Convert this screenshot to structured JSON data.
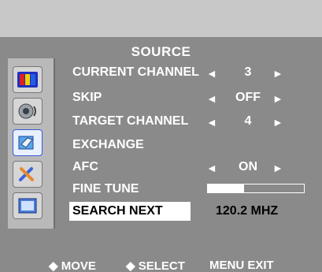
{
  "menu": {
    "title": "SOURCE"
  },
  "rows": {
    "current_channel": {
      "label": "CURRENT CHANNEL",
      "value": "3"
    },
    "skip": {
      "label": "SKIP",
      "value": "OFF"
    },
    "target_channel": {
      "label": "TARGET CHANNEL",
      "value": "4"
    },
    "exchange": {
      "label": "EXCHANGE"
    },
    "afc": {
      "label": "AFC",
      "value": "ON"
    },
    "fine_tune": {
      "label": "FINE TUNE",
      "level": 0.38
    },
    "search_next": {
      "label": "SEARCH NEXT",
      "frequency": "120.2 MHZ"
    }
  },
  "arrows": {
    "left": "◄",
    "right": "►"
  },
  "footer": {
    "move": "◆ MOVE",
    "select": "◆ SELECT",
    "exit": "MENU EXIT"
  },
  "icons": [
    "color-bars-icon",
    "speaker-icon",
    "setup-icon",
    "tools-icon",
    "screen-icon"
  ],
  "colors": {
    "background": "#8a8a8a",
    "highlight": "#ffffff",
    "text": "#ffffff",
    "selected_text": "#000000"
  }
}
